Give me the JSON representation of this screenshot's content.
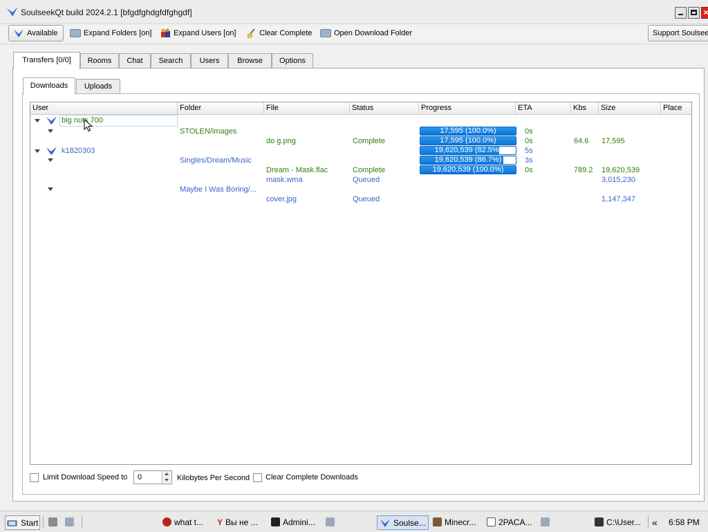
{
  "window": {
    "title": "SoulseekQt build 2024.2.1 [bfgdfghdgfdfghgdf]"
  },
  "toolbar": {
    "available": "Available",
    "expand_folders": "Expand Folders [on]",
    "expand_users": "Expand Users [on]",
    "clear_complete": "Clear Complete",
    "open_download_folder": "Open Download Folder",
    "support": "Support Soulseek"
  },
  "tabs": [
    "Transfers [0/0]",
    "Rooms",
    "Chat",
    "Search",
    "Users",
    "Browse",
    "Options"
  ],
  "subtabs": [
    "Downloads",
    "Uploads"
  ],
  "columns": [
    "User",
    "Folder",
    "File",
    "Status",
    "Progress",
    "ETA",
    "Kbs",
    "Size",
    "Place"
  ],
  "rows": {
    "user1": "big nuts 700",
    "folder1": "STOLEN/images",
    "file1": {
      "name": "do g.png",
      "status": "Complete",
      "eta": "0s",
      "kbs": "64.6",
      "size": "17,595"
    },
    "folder1_progress": {
      "text": "17,595 (100.0%)",
      "pct": 100,
      "eta": "0s"
    },
    "file1_progress": {
      "text": "17,595 (100.0%)",
      "pct": 100
    },
    "user2": "k1820303",
    "user2_progress": {
      "text": "19,620,539 (82.5%)",
      "pct": 82.5,
      "eta": "5s"
    },
    "folder2": "Singles/Dream/Music",
    "folder2_progress": {
      "text": "19,620,539 (86.7%)",
      "pct": 86.7,
      "eta": "3s"
    },
    "file2": {
      "name": "Dream - Mask.flac",
      "status": "Complete",
      "eta": "0s",
      "kbs": "789.2",
      "size": "19,620,539",
      "progress_text": "19,620,539 (100.0%)",
      "pct": 100
    },
    "file3": {
      "name": "mask.wma",
      "status": "Queued",
      "size": "3,015,230"
    },
    "folder3": "Maybe I Was Boring/...",
    "file4": {
      "name": "cover.jpg",
      "status": "Queued",
      "size": "1,147,347"
    }
  },
  "bottom": {
    "limit_label": "Limit Download Speed to",
    "speed_value": "0",
    "unit_label": "Kilobytes Per Second",
    "clear_label": "Clear Complete Downloads"
  },
  "taskbar": {
    "start": "Start",
    "items": [
      "what t...",
      "Вы не ...",
      "Admini...",
      "Soulse...",
      "Minecr...",
      "2PACA...",
      "C:\\User..."
    ],
    "clock": "6:58 PM",
    "chevron": "«"
  },
  "colors": {
    "progress": "#0a76dc",
    "green_text": "#2e7d12",
    "blue_text": "#3b63c8",
    "close": "#d9261c"
  }
}
